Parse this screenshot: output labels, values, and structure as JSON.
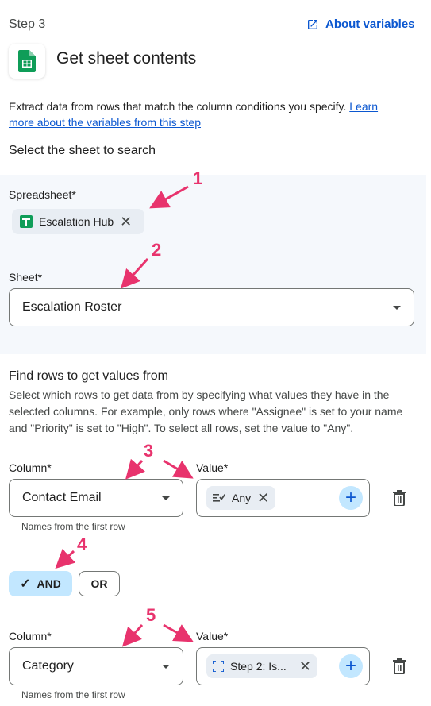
{
  "header": {
    "step_label": "Step 3",
    "about_link": "About variables",
    "title": "Get sheet contents"
  },
  "description": {
    "text": "Extract data from rows that match the column conditions you specify. ",
    "link": "Learn more about the variables from this step"
  },
  "select_sheet": {
    "section_title": "Select the sheet to search",
    "spreadsheet_label": "Spreadsheet*",
    "spreadsheet_chip": "Escalation Hub",
    "sheet_label": "Sheet*",
    "sheet_value": "Escalation Roster"
  },
  "find_rows": {
    "section_title": "Find rows to get values from",
    "description": "Select which rows to get data from by specifying what values they have in the selected columns. For example, only rows where \"Assignee\" is set to your name and \"Priority\" is set to \"High\". To select all rows, set the value to \"Any\".",
    "conditions": [
      {
        "column_label": "Column*",
        "column_value": "Contact Email",
        "value_label": "Value*",
        "value_chip": "Any",
        "helper": "Names from the first row"
      },
      {
        "column_label": "Column*",
        "column_value": "Category",
        "value_label": "Value*",
        "value_chip": "Step 2: Is...",
        "helper": "Names from the first row"
      }
    ],
    "operator": {
      "and_label": "AND",
      "or_label": "OR",
      "selected": "AND"
    }
  },
  "annotations": {
    "markers": [
      "1",
      "2",
      "3",
      "4",
      "5"
    ],
    "color": "#e8336d"
  },
  "colors": {
    "accent": "#0b57d0",
    "chip_blue": "#c2e7ff",
    "sheets_green": "#0f9d58",
    "panel_bg": "#f5f8fc"
  }
}
